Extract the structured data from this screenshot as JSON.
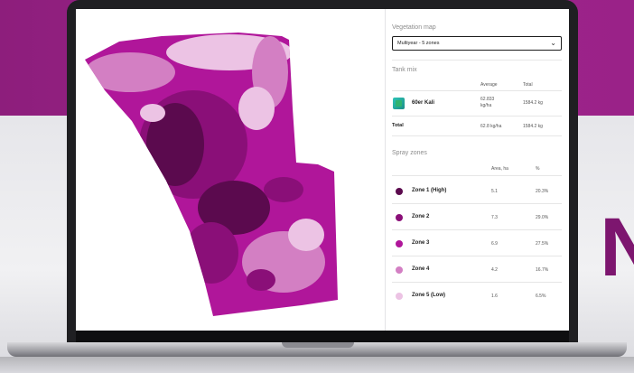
{
  "vegetation_map": {
    "title": "Vegetation map",
    "selected": "Multiyear - 5 zones"
  },
  "tank_mix": {
    "title": "Tank mix",
    "columns": {
      "average": "Average",
      "total": "Total"
    },
    "product": {
      "name": "60er Kali",
      "average_value": "62.833",
      "average_unit": "kg/ha",
      "total": "1584.2 kg"
    },
    "total_row": {
      "label": "Total",
      "average": "62.8 kg/ha",
      "total": "1584.2 kg"
    }
  },
  "spray_zones": {
    "title": "Spray zones",
    "columns": {
      "area": "Area, ha",
      "percent": "%"
    },
    "zones": [
      {
        "name": "Zone 1 (High)",
        "area": "5.1",
        "percent": "20.3%",
        "color": "#5b0a4e"
      },
      {
        "name": "Zone 2",
        "area": "7.3",
        "percent": "29.0%",
        "color": "#8a0f78"
      },
      {
        "name": "Zone 3",
        "area": "6.9",
        "percent": "27.5%",
        "color": "#b0169a"
      },
      {
        "name": "Zone 4",
        "area": "4.2",
        "percent": "16.7%",
        "color": "#d37fc3"
      },
      {
        "name": "Zone 5 (Low)",
        "area": "1.6",
        "percent": "6.5%",
        "color": "#ecc3e4"
      }
    ]
  },
  "background_text": "N",
  "colors": {
    "brand_band": "#9a2288",
    "accent": "#8a0f78"
  }
}
